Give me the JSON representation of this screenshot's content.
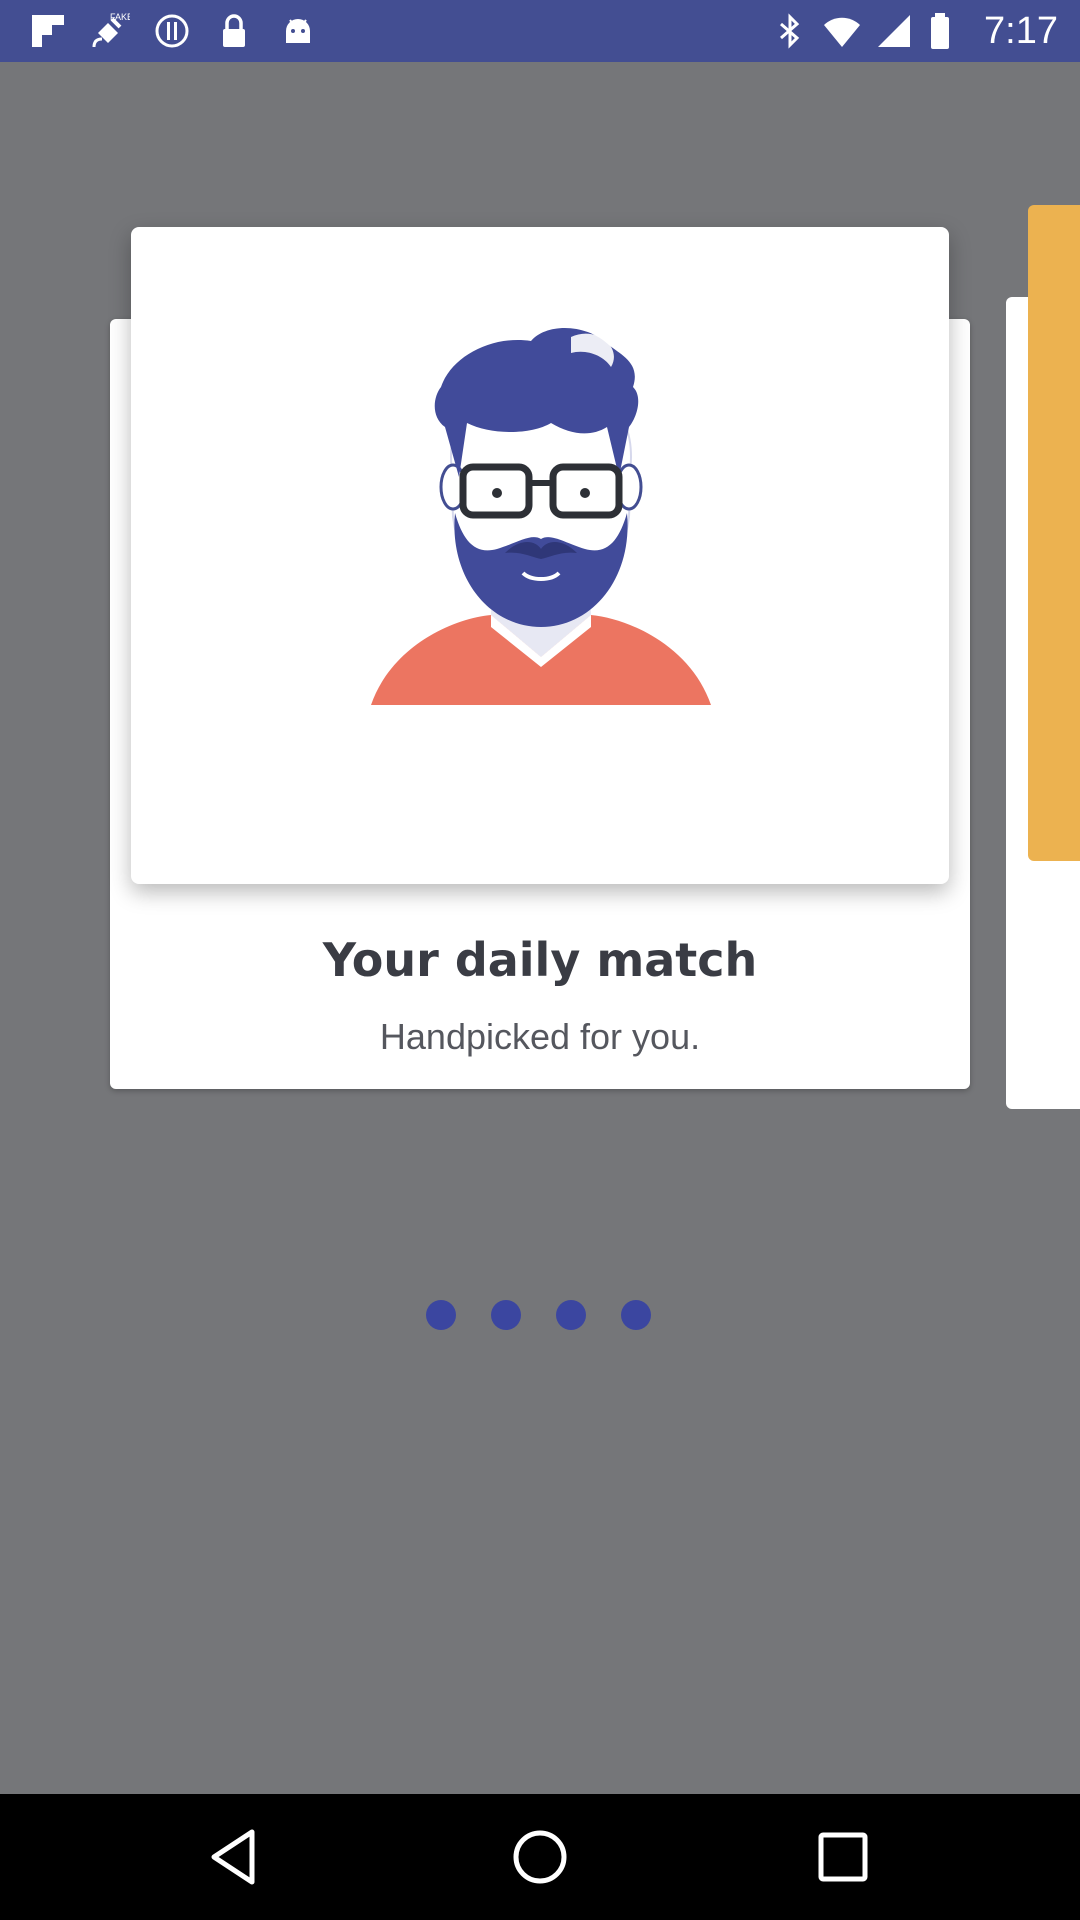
{
  "status_bar": {
    "time": "7:17",
    "left_icons": [
      "flipboard-icon",
      "fake-gps-icon",
      "info-icon",
      "lock-icon",
      "android-icon"
    ],
    "right_icons": [
      "bluetooth-icon",
      "wifi-icon",
      "signal-icon",
      "battery-icon"
    ],
    "color": "#434e92"
  },
  "onboarding": {
    "cards": [
      {
        "title": "Your daily match",
        "subtitle": "Handpicked for you.",
        "illustration": "bearded-man-avatar"
      }
    ],
    "next_card_accent": "#ecb250",
    "pager": {
      "count": 4,
      "active_color": "#3b46a0"
    }
  },
  "nav_bar": {
    "buttons": [
      "back-icon",
      "home-icon",
      "recents-icon"
    ]
  }
}
